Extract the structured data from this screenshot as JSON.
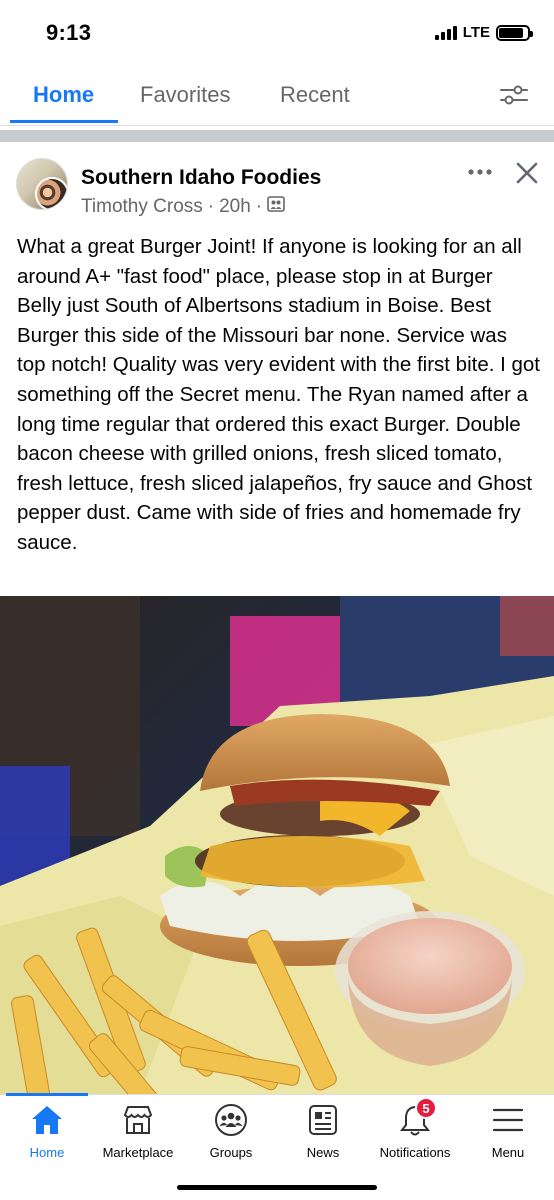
{
  "status_bar": {
    "time": "9:13",
    "network": "LTE",
    "battery_level": 0.85
  },
  "tabs": [
    {
      "label": "Home",
      "active": true
    },
    {
      "label": "Favorites",
      "active": false
    },
    {
      "label": "Recent",
      "active": false
    }
  ],
  "filter_icon": "sliders-icon",
  "post": {
    "group_name": "Southern Idaho Foodies",
    "author": "Timothy Cross",
    "time_ago": "20h",
    "separator": "·",
    "audience_icon": "group-icon",
    "text": "What a great Burger Joint!  If anyone is looking for an all around A+ \"fast food\" place, please stop in at Burger Belly just South of Albertsons stadium in Boise.  Best Burger this side of the Missouri bar none.  Service was top notch! Quality was very evident with the first bite.  I got something off the Secret menu.  The Ryan named after a long time regular that ordered this exact Burger.  Double bacon cheese with grilled onions, fresh sliced tomato, fresh lettuce,  fresh sliced jalapeños, fry sauce and Ghost pepper dust. Came with side of fries and homemade fry sauce.",
    "photo_subject": "burger-with-fries-and-fry-sauce"
  },
  "bottom_nav": [
    {
      "label": "Home",
      "icon": "home-icon",
      "active": true
    },
    {
      "label": "Marketplace",
      "icon": "marketplace-icon",
      "active": false
    },
    {
      "label": "Groups",
      "icon": "groups-icon",
      "active": false
    },
    {
      "label": "News",
      "icon": "news-icon",
      "active": false
    },
    {
      "label": "Notifications",
      "icon": "bell-icon",
      "active": false,
      "badge": "5"
    },
    {
      "label": "Menu",
      "icon": "menu-icon",
      "active": false
    }
  ],
  "colors": {
    "accent": "#1877f2",
    "badge": "#e41e3f",
    "secondary_text": "#65676b"
  }
}
